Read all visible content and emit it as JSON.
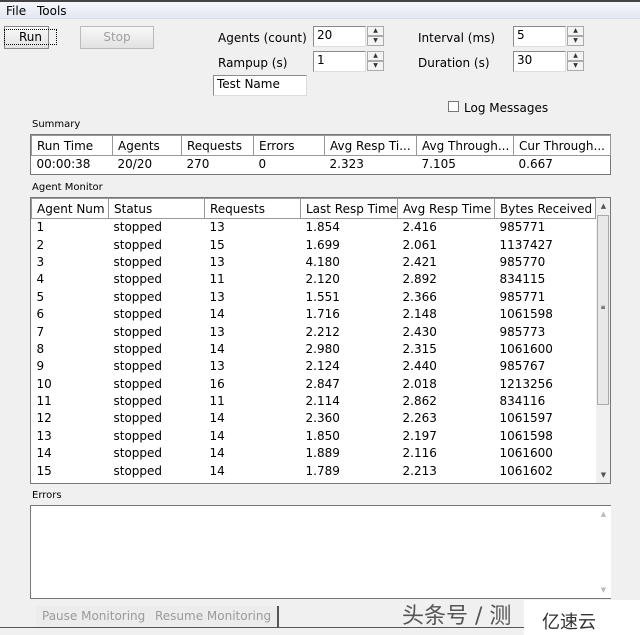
{
  "menu": [
    "File",
    "Tools"
  ],
  "controls": {
    "run": "Run",
    "stop": "Stop",
    "agents_label": "Agents (count)",
    "agents": "20",
    "rampup_label": "Rampup (s)",
    "rampup": "1",
    "interval_label": "Interval (ms)",
    "interval": "5",
    "duration_label": "Duration (s)",
    "duration": "30",
    "test_name": "Test Name",
    "log_messages": "Log Messages",
    "log_checked": false
  },
  "summary": {
    "label": "Summary",
    "columns": [
      "Run Time",
      "Agents",
      "Requests",
      "Errors",
      "Avg Resp Ti...",
      "Avg Through...",
      "Cur Through..."
    ],
    "row": [
      "00:00:38",
      "20/20",
      "270",
      "0",
      "2.323",
      "7.105",
      "0.667"
    ]
  },
  "agent_monitor": {
    "label": "Agent Monitor",
    "columns": [
      "Agent Num",
      "Status",
      "Requests",
      "Last Resp Time",
      "Avg Resp Time",
      "Bytes Received"
    ],
    "rows": [
      [
        "1",
        "stopped",
        "13",
        "1.854",
        "2.416",
        "985771"
      ],
      [
        "2",
        "stopped",
        "15",
        "1.699",
        "2.061",
        "1137427"
      ],
      [
        "3",
        "stopped",
        "13",
        "4.180",
        "2.421",
        "985770"
      ],
      [
        "4",
        "stopped",
        "11",
        "2.120",
        "2.892",
        "834115"
      ],
      [
        "5",
        "stopped",
        "13",
        "1.551",
        "2.366",
        "985771"
      ],
      [
        "6",
        "stopped",
        "14",
        "1.716",
        "2.148",
        "1061598"
      ],
      [
        "7",
        "stopped",
        "13",
        "2.212",
        "2.430",
        "985773"
      ],
      [
        "8",
        "stopped",
        "14",
        "2.980",
        "2.315",
        "1061600"
      ],
      [
        "9",
        "stopped",
        "13",
        "2.124",
        "2.440",
        "985767"
      ],
      [
        "10",
        "stopped",
        "16",
        "2.847",
        "2.018",
        "1213256"
      ],
      [
        "11",
        "stopped",
        "11",
        "2.114",
        "2.862",
        "834116"
      ],
      [
        "12",
        "stopped",
        "14",
        "2.360",
        "2.263",
        "1061597"
      ],
      [
        "13",
        "stopped",
        "14",
        "1.850",
        "2.197",
        "1061598"
      ],
      [
        "14",
        "stopped",
        "14",
        "1.889",
        "2.116",
        "1061600"
      ],
      [
        "15",
        "stopped",
        "14",
        "1.789",
        "2.213",
        "1061602"
      ]
    ]
  },
  "errors": {
    "label": "Errors",
    "text": ""
  },
  "bottom": {
    "pause": "Pause Monitoring",
    "resume": "Resume Monitoring"
  },
  "watermark": {
    "text": "头条号 / 测",
    "logo": "亿速云"
  }
}
